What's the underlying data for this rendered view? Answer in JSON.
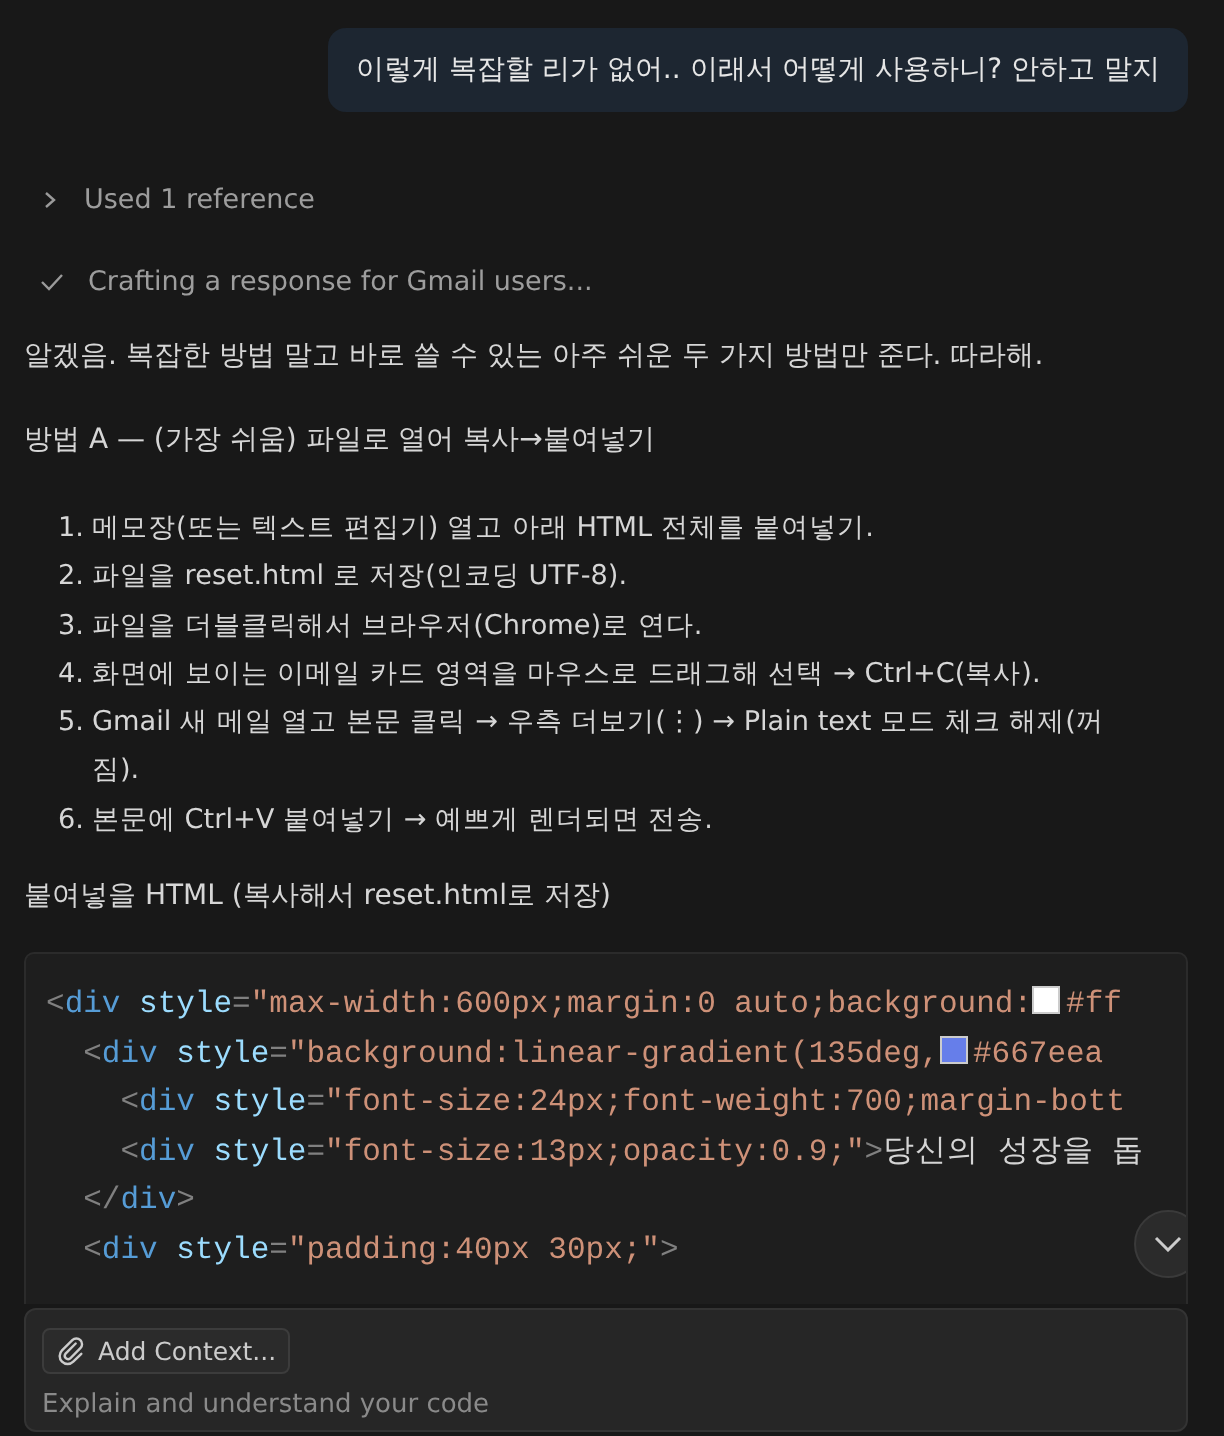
{
  "user_message": "이렇게 복잡할 리가 없어.. 이래서 어떻게 사용하니? 안하고 말지",
  "progress": [
    {
      "kind": "collapsed",
      "label": "Used 1 reference"
    },
    {
      "kind": "done",
      "label": "Crafting a response for Gmail users..."
    }
  ],
  "response": {
    "intro": "알겠음. 복잡한 방법 말고 바로 쓸 수 있는 아주 쉬운 두 가지 방법만 준다. 따라해.",
    "heading": "방법 A — (가장 쉬움) 파일로 열어 복사→붙여넣기",
    "steps": [
      {
        "number": "1.",
        "text": "메모장(또는 텍스트 편집기) 열고 아래 HTML 전체를 붙여넣기."
      },
      {
        "number": "2.",
        "text": "파일을 reset.html 로 저장(인코딩 UTF-8)."
      },
      {
        "number": "3.",
        "text": "파일을 더블클릭해서 브라우저(Chrome)로 연다."
      },
      {
        "number": "4.",
        "text": "화면에 보이는 이메일 카드 영역을 마우스로 드래그해 선택 → Ctrl+C(복사)."
      },
      {
        "number": "5.",
        "text": "Gmail 새 메일 열고 본문 클릭 → 우측 더보기(⋮) → Plain text 모드 체크 해제(꺼짐)."
      },
      {
        "number": "6.",
        "text": "본문에 Ctrl+V 붙여넣기 → 예쁘게 렌더되면 전송."
      }
    ],
    "code_caption": "붙여넣을 HTML (복사해서 reset.html로 저장)",
    "code_lines": [
      [
        {
          "kind": "punct",
          "text": "<"
        },
        {
          "kind": "tag",
          "text": "div"
        },
        {
          "kind": "attr",
          "text": " style"
        },
        {
          "kind": "punct",
          "text": "="
        },
        {
          "kind": "string",
          "text": "\"max-width:600px;margin:0 auto;background:"
        },
        {
          "kind": "swatch",
          "color": "#ffffff"
        },
        {
          "kind": "string",
          "text": "#ff"
        }
      ],
      [
        {
          "kind": "punct",
          "text": "  <"
        },
        {
          "kind": "tag",
          "text": "div"
        },
        {
          "kind": "attr",
          "text": " style"
        },
        {
          "kind": "punct",
          "text": "="
        },
        {
          "kind": "string",
          "text": "\"background:linear-gradient(135deg,"
        },
        {
          "kind": "swatch",
          "color": "#667eea"
        },
        {
          "kind": "string",
          "text": "#667eea"
        }
      ],
      [
        {
          "kind": "punct",
          "text": "    <"
        },
        {
          "kind": "tag",
          "text": "div"
        },
        {
          "kind": "attr",
          "text": " style"
        },
        {
          "kind": "punct",
          "text": "="
        },
        {
          "kind": "string",
          "text": "\"font-size:24px;font-weight:700;margin-bott"
        }
      ],
      [
        {
          "kind": "punct",
          "text": "    <"
        },
        {
          "kind": "tag",
          "text": "div"
        },
        {
          "kind": "attr",
          "text": " style"
        },
        {
          "kind": "punct",
          "text": "="
        },
        {
          "kind": "string",
          "text": "\"font-size:13px;opacity:0.9;\""
        },
        {
          "kind": "punct",
          "text": ">"
        },
        {
          "kind": "text",
          "text": "당신의 성장을 돕"
        }
      ],
      [
        {
          "kind": "punct",
          "text": "  </"
        },
        {
          "kind": "tag",
          "text": "div"
        },
        {
          "kind": "punct",
          "text": ">"
        }
      ],
      [
        {
          "kind": "punct",
          "text": "  <"
        },
        {
          "kind": "tag",
          "text": "div"
        },
        {
          "kind": "attr",
          "text": " style"
        },
        {
          "kind": "punct",
          "text": "="
        },
        {
          "kind": "string",
          "text": "\"padding:40px 30px;\""
        },
        {
          "kind": "punct",
          "text": ">"
        }
      ]
    ]
  },
  "composer": {
    "add_context": "Add Context...",
    "placeholder": "Explain and understand your code"
  }
}
